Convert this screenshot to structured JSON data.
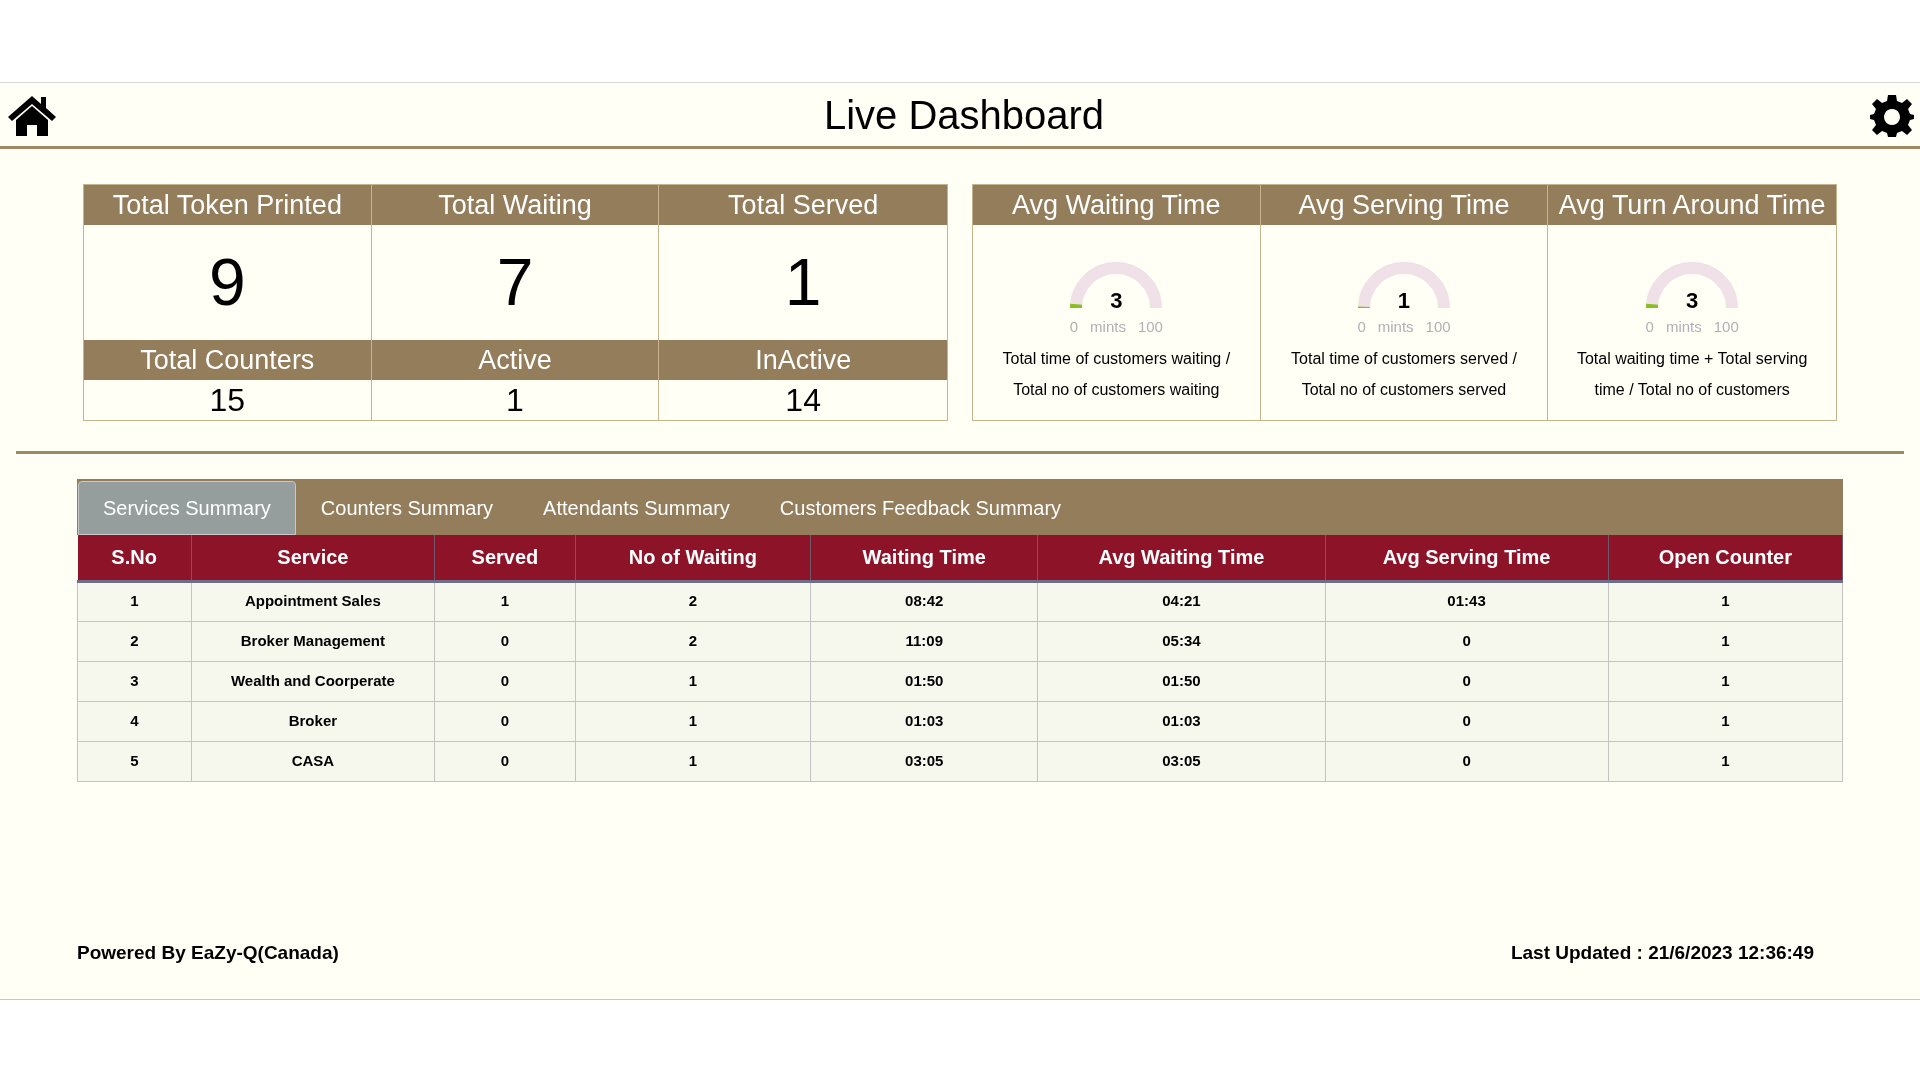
{
  "header": {
    "title": "Live Dashboard"
  },
  "stats": [
    {
      "label": "Total Token Printed",
      "value": "9",
      "kind": "primary"
    },
    {
      "label": "Total Waiting",
      "value": "7",
      "kind": "primary"
    },
    {
      "label": "Total Served",
      "value": "1",
      "kind": "primary"
    },
    {
      "label": "Total Counters",
      "value": "15",
      "kind": "secondary"
    },
    {
      "label": "Active",
      "value": "1",
      "kind": "secondary"
    },
    {
      "label": "InActive",
      "value": "14",
      "kind": "secondary"
    }
  ],
  "gauges": [
    {
      "title": "Avg Waiting Time",
      "value": "3",
      "level": 0.03,
      "min": "0",
      "unit": "mints",
      "max": "100",
      "description": "Total time of customers waiting / Total no of customers waiting"
    },
    {
      "title": "Avg Serving Time",
      "value": "1",
      "level": 0.01,
      "min": "0",
      "unit": "mints",
      "max": "100",
      "description": "Total time of customers served / Total no of customers served"
    },
    {
      "title": "Avg Turn Around Time",
      "value": "3",
      "level": 0.03,
      "min": "0",
      "unit": "mints",
      "max": "100",
      "description": "Total waiting time + Total serving time / Total no of customers"
    }
  ],
  "tabs": [
    {
      "label": "Services Summary",
      "selected": true
    },
    {
      "label": "Counters Summary",
      "selected": false
    },
    {
      "label": "Attendants Summary",
      "selected": false
    },
    {
      "label": "Customers Feedback Summary",
      "selected": false
    }
  ],
  "table": {
    "columns": [
      "S.No",
      "Service",
      "Served",
      "No of Waiting",
      "Waiting Time",
      "Avg Waiting Time",
      "Avg Serving Time",
      "Open Counter"
    ],
    "rows": [
      [
        "1",
        "Appointment Sales",
        "1",
        "2",
        "08:42",
        "04:21",
        "01:43",
        "1"
      ],
      [
        "2",
        "Broker Management",
        "0",
        "2",
        "11:09",
        "05:34",
        "0",
        "1"
      ],
      [
        "3",
        "Wealth and Coorperate",
        "0",
        "1",
        "01:50",
        "01:50",
        "0",
        "1"
      ],
      [
        "4",
        "Broker",
        "0",
        "1",
        "01:03",
        "01:03",
        "0",
        "1"
      ],
      [
        "5",
        "CASA",
        "0",
        "1",
        "03:05",
        "03:05",
        "0",
        "1"
      ]
    ]
  },
  "footer": {
    "powered_by": "Powered By EaZy-Q(Canada)",
    "last_updated": "Last Updated : 21/6/2023 12:36:49"
  }
}
